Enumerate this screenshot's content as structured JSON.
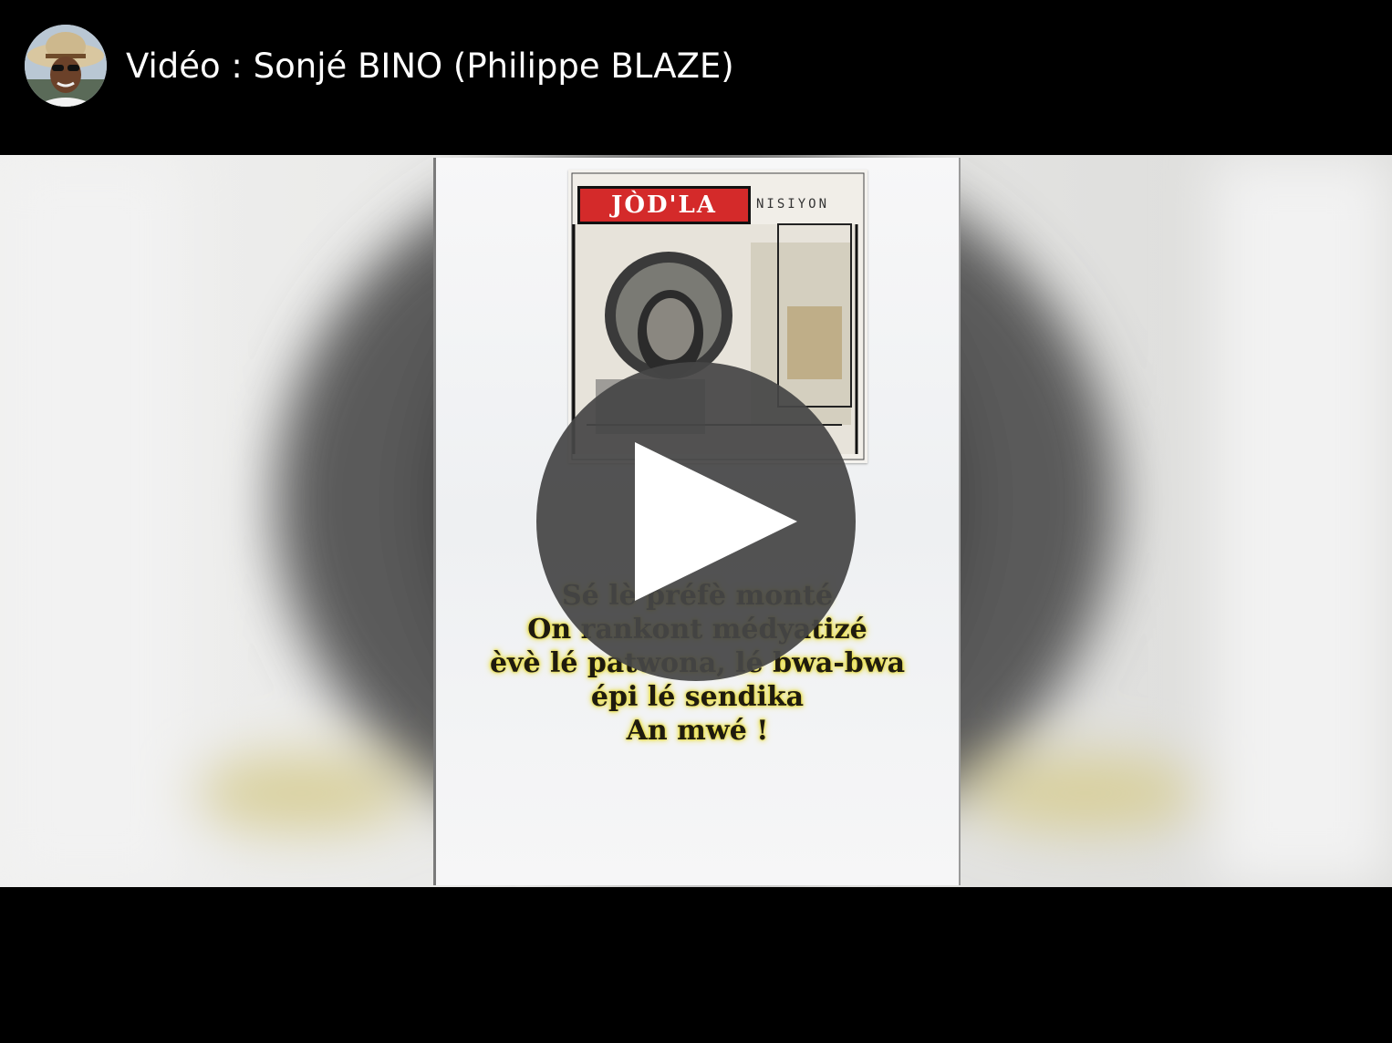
{
  "header": {
    "title": "Vidéo : Sonjé BINO (Philippe BLAZE)",
    "avatar_icon": "channel-avatar"
  },
  "video": {
    "cover": {
      "label": "JÒD'LA",
      "sublabel": "NISIYON"
    },
    "lyrics": [
      "Sé lè préfè monté",
      "On rankont médyatizé",
      "èvè lé patwona, lé bwa-bwa",
      "épi lé sendika",
      "An mwé !"
    ],
    "play_icon": "play-icon"
  },
  "colors": {
    "background": "#000000",
    "title_text": "#ffffff",
    "play_button": "#464646",
    "cover_label": "#d42a2a",
    "lyrics_glow": "#e9dd3a"
  }
}
